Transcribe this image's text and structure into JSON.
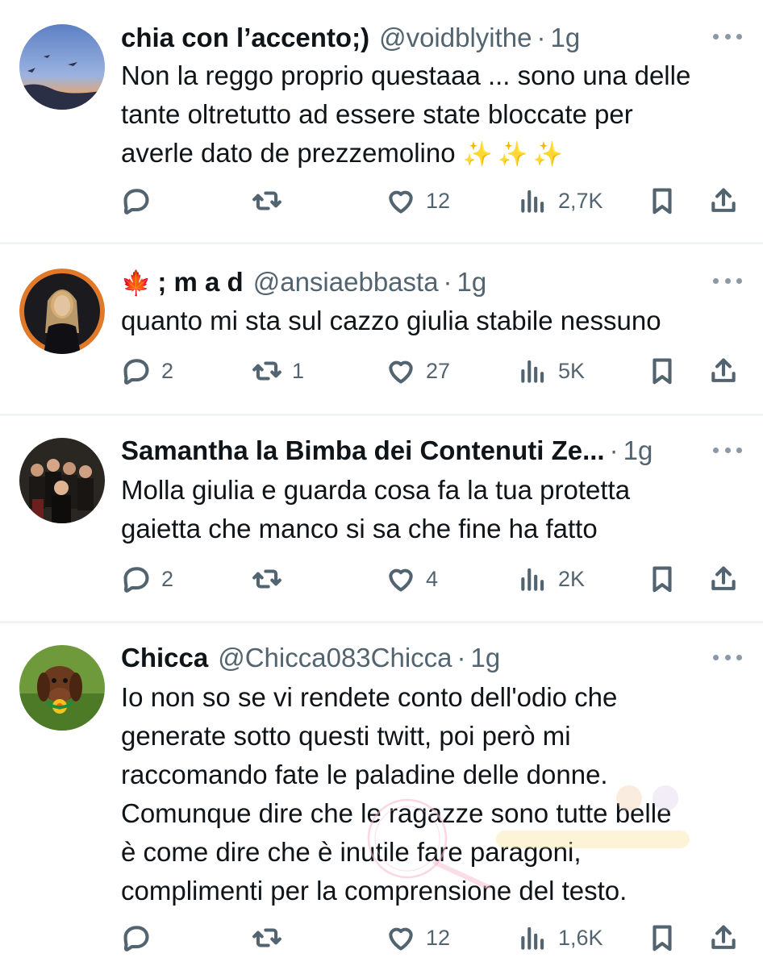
{
  "icons": {
    "reply": "reply-icon",
    "retweet": "retweet-icon",
    "like": "heart-icon",
    "views": "views-icon",
    "bookmark": "bookmark-icon",
    "share": "share-icon",
    "more": "more-icon"
  },
  "colors": {
    "text": "#0f1419",
    "secondary": "#536471",
    "divider": "#eff3f4"
  },
  "tweets": [
    {
      "name": "chia con l’accento;)",
      "handle": "@voidblyithe",
      "time": "1g",
      "text": "Non la reggo proprio questaaa ... sono una delle\ntante oltretutto ad essere state bloccate per\naverle dato de prezzemolino",
      "emoji": "✨✨✨",
      "replies": "",
      "retweets": "",
      "likes": "12",
      "views": "2,7K"
    },
    {
      "name_prefix": "🍁",
      "name": "; m a d",
      "handle": "@ansiaebbasta",
      "time": "1g",
      "text": "quanto mi sta sul cazzo giulia stabile nessuno",
      "replies": "2",
      "retweets": "1",
      "likes": "27",
      "views": "5K"
    },
    {
      "name": "Samantha la Bimba dei Contenuti Ze...",
      "handle": "",
      "time": "1g",
      "text": "Molla giulia e guarda cosa fa la tua protetta\ngaietta che manco si sa che fine ha fatto",
      "replies": "2",
      "retweets": "",
      "likes": "4",
      "views": "2K"
    },
    {
      "name": "Chicca",
      "handle": "@Chicca083Chicca",
      "time": "1g",
      "text": "Io non so se vi rendete conto dell'odio che\ngenerate sotto questi twitt, poi però mi\nraccomando fate le paladine delle donne.\nComunque dire che le ragazze sono tutte belle\nè come dire che è inutile fare paragoni,\ncomplimenti per la comprensione del testo.",
      "replies": "",
      "retweets": "",
      "likes": "12",
      "views": "1,6K"
    }
  ]
}
